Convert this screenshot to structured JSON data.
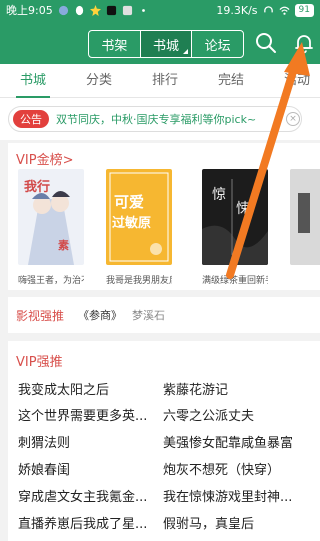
{
  "status": {
    "time": "晚上9:05",
    "speed": "19.3K/s",
    "battery": "91"
  },
  "header": {
    "seg": [
      "书架",
      "书城",
      "论坛"
    ]
  },
  "tabs": [
    "书城",
    "分类",
    "排行",
    "完结",
    "活动"
  ],
  "notice": {
    "badge": "公告",
    "text": "双节同庆，中秋·国庆专享福利等你pick~",
    "close": "×"
  },
  "vip": {
    "title": "VIP金榜>",
    "books": [
      {
        "caption": "嗨强王者，为治不",
        "cover_text": "我行我素"
      },
      {
        "caption": "我哥是我男朋友后",
        "cover_text": "可爱过敏原"
      },
      {
        "caption": "满级绿茶重回新手",
        "cover_text": "惊悚"
      },
      {
        "caption": "",
        "cover_text": ""
      }
    ]
  },
  "drama": {
    "title": "影视强推",
    "book": "《参商》",
    "author": "梦溪石"
  },
  "rec": {
    "title": "VIP强推",
    "left": [
      "我变成太阳之后",
      "这个世界需要更多英...",
      "刺猬法则",
      "娇娘春闺",
      "穿成虐文女主我氪金...",
      "直播养崽后我成了星..."
    ],
    "right": [
      "紫藤花游记",
      "六零之公派丈夫",
      "美强惨女配靠咸鱼暴富",
      "炮灰不想死（快穿）",
      "我在惊悚游戏里封神...",
      "假驸马，真皇后"
    ]
  }
}
